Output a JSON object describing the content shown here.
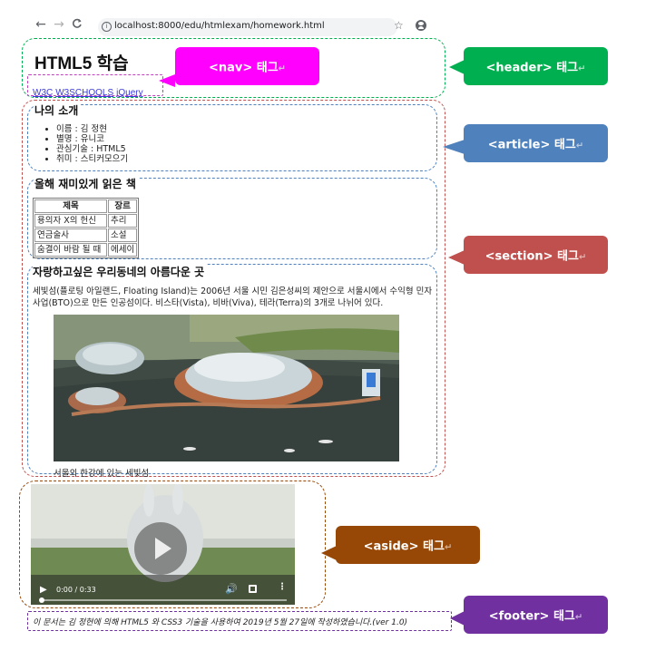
{
  "browser": {
    "url": "localhost:8000/edu/htmlexam/homework.html",
    "back": "←",
    "forward": "→",
    "reload": "C"
  },
  "header": {
    "title": "HTML5 학습",
    "nav_links": [
      "W3C",
      "W3SCHOOLS",
      "jQuery"
    ]
  },
  "article": {
    "heading": "나의 소개",
    "items": [
      "이름 : 김 정현",
      "별명 : 유니코",
      "관심기술 : HTML5",
      "취미 : 스티커모으기"
    ]
  },
  "books": {
    "heading": "올해 재미있게 읽은 책",
    "columns": [
      "제목",
      "장르"
    ],
    "rows": [
      [
        "용의자 X의 헌신",
        "추리"
      ],
      [
        "연금술사",
        "소설"
      ],
      [
        "숨결이 바람 될 때",
        "에세이"
      ]
    ]
  },
  "section": {
    "heading": "자랑하고싶은 우리동네의 아름다운 곳",
    "paragraph": "세빛섬(플로팅 아일랜드, Floating Island)는 2006년 서울 시민 김은성씨의 제안으로 서울시에서 수익형 민자사업(BTO)으로 만든 인공섬이다. 비스타(Vista), 비바(Viva), 테라(Terra)의 3개로 나뉘어 있다.",
    "caption": "서울의 한강에 있는 세빛섬"
  },
  "video": {
    "time": "0:00 / 0:33"
  },
  "footer": {
    "text": "이 문서는 김 정현에 의해 HTML5 와 CSS3 기술을 사용하여 2019년 5월 27일에 작성하였습니다.(ver 1.0)"
  },
  "callouts": {
    "nav": "<nav> 태그",
    "header": "<header> 태그",
    "article": "<article> 태그",
    "section": "<section> 태그",
    "aside": "<aside> 태그",
    "footer": "<footer> 태그",
    "return_mark": "↵"
  },
  "colors": {
    "nav": "#ff00ff",
    "header": "#00b050",
    "article": "#4f81bd",
    "section": "#c0504d",
    "aside": "#984806",
    "footer": "#7030a0"
  }
}
